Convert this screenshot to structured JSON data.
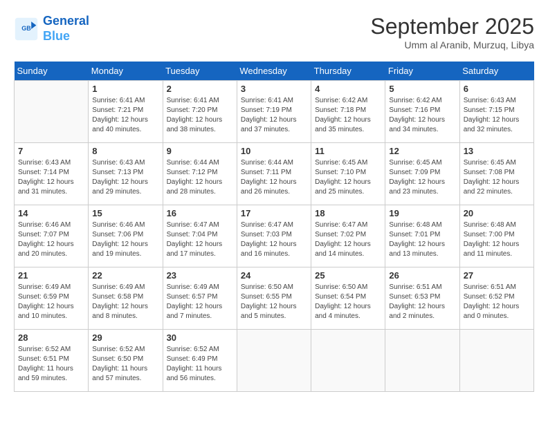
{
  "header": {
    "logo_line1": "General",
    "logo_line2": "Blue",
    "month": "September 2025",
    "location": "Umm al Aranib, Murzuq, Libya"
  },
  "days_of_week": [
    "Sunday",
    "Monday",
    "Tuesday",
    "Wednesday",
    "Thursday",
    "Friday",
    "Saturday"
  ],
  "weeks": [
    [
      {
        "day": "",
        "empty": true
      },
      {
        "day": "1",
        "sunrise": "6:41 AM",
        "sunset": "7:21 PM",
        "daylight": "12 hours and 40 minutes."
      },
      {
        "day": "2",
        "sunrise": "6:41 AM",
        "sunset": "7:20 PM",
        "daylight": "12 hours and 38 minutes."
      },
      {
        "day": "3",
        "sunrise": "6:41 AM",
        "sunset": "7:19 PM",
        "daylight": "12 hours and 37 minutes."
      },
      {
        "day": "4",
        "sunrise": "6:42 AM",
        "sunset": "7:18 PM",
        "daylight": "12 hours and 35 minutes."
      },
      {
        "day": "5",
        "sunrise": "6:42 AM",
        "sunset": "7:16 PM",
        "daylight": "12 hours and 34 minutes."
      },
      {
        "day": "6",
        "sunrise": "6:43 AM",
        "sunset": "7:15 PM",
        "daylight": "12 hours and 32 minutes."
      }
    ],
    [
      {
        "day": "7",
        "sunrise": "6:43 AM",
        "sunset": "7:14 PM",
        "daylight": "12 hours and 31 minutes."
      },
      {
        "day": "8",
        "sunrise": "6:43 AM",
        "sunset": "7:13 PM",
        "daylight": "12 hours and 29 minutes."
      },
      {
        "day": "9",
        "sunrise": "6:44 AM",
        "sunset": "7:12 PM",
        "daylight": "12 hours and 28 minutes."
      },
      {
        "day": "10",
        "sunrise": "6:44 AM",
        "sunset": "7:11 PM",
        "daylight": "12 hours and 26 minutes."
      },
      {
        "day": "11",
        "sunrise": "6:45 AM",
        "sunset": "7:10 PM",
        "daylight": "12 hours and 25 minutes."
      },
      {
        "day": "12",
        "sunrise": "6:45 AM",
        "sunset": "7:09 PM",
        "daylight": "12 hours and 23 minutes."
      },
      {
        "day": "13",
        "sunrise": "6:45 AM",
        "sunset": "7:08 PM",
        "daylight": "12 hours and 22 minutes."
      }
    ],
    [
      {
        "day": "14",
        "sunrise": "6:46 AM",
        "sunset": "7:07 PM",
        "daylight": "12 hours and 20 minutes."
      },
      {
        "day": "15",
        "sunrise": "6:46 AM",
        "sunset": "7:06 PM",
        "daylight": "12 hours and 19 minutes."
      },
      {
        "day": "16",
        "sunrise": "6:47 AM",
        "sunset": "7:04 PM",
        "daylight": "12 hours and 17 minutes."
      },
      {
        "day": "17",
        "sunrise": "6:47 AM",
        "sunset": "7:03 PM",
        "daylight": "12 hours and 16 minutes."
      },
      {
        "day": "18",
        "sunrise": "6:47 AM",
        "sunset": "7:02 PM",
        "daylight": "12 hours and 14 minutes."
      },
      {
        "day": "19",
        "sunrise": "6:48 AM",
        "sunset": "7:01 PM",
        "daylight": "12 hours and 13 minutes."
      },
      {
        "day": "20",
        "sunrise": "6:48 AM",
        "sunset": "7:00 PM",
        "daylight": "12 hours and 11 minutes."
      }
    ],
    [
      {
        "day": "21",
        "sunrise": "6:49 AM",
        "sunset": "6:59 PM",
        "daylight": "12 hours and 10 minutes."
      },
      {
        "day": "22",
        "sunrise": "6:49 AM",
        "sunset": "6:58 PM",
        "daylight": "12 hours and 8 minutes."
      },
      {
        "day": "23",
        "sunrise": "6:49 AM",
        "sunset": "6:57 PM",
        "daylight": "12 hours and 7 minutes."
      },
      {
        "day": "24",
        "sunrise": "6:50 AM",
        "sunset": "6:55 PM",
        "daylight": "12 hours and 5 minutes."
      },
      {
        "day": "25",
        "sunrise": "6:50 AM",
        "sunset": "6:54 PM",
        "daylight": "12 hours and 4 minutes."
      },
      {
        "day": "26",
        "sunrise": "6:51 AM",
        "sunset": "6:53 PM",
        "daylight": "12 hours and 2 minutes."
      },
      {
        "day": "27",
        "sunrise": "6:51 AM",
        "sunset": "6:52 PM",
        "daylight": "12 hours and 0 minutes."
      }
    ],
    [
      {
        "day": "28",
        "sunrise": "6:52 AM",
        "sunset": "6:51 PM",
        "daylight": "11 hours and 59 minutes."
      },
      {
        "day": "29",
        "sunrise": "6:52 AM",
        "sunset": "6:50 PM",
        "daylight": "11 hours and 57 minutes."
      },
      {
        "day": "30",
        "sunrise": "6:52 AM",
        "sunset": "6:49 PM",
        "daylight": "11 hours and 56 minutes."
      },
      {
        "day": "",
        "empty": true
      },
      {
        "day": "",
        "empty": true
      },
      {
        "day": "",
        "empty": true
      },
      {
        "day": "",
        "empty": true
      }
    ]
  ]
}
